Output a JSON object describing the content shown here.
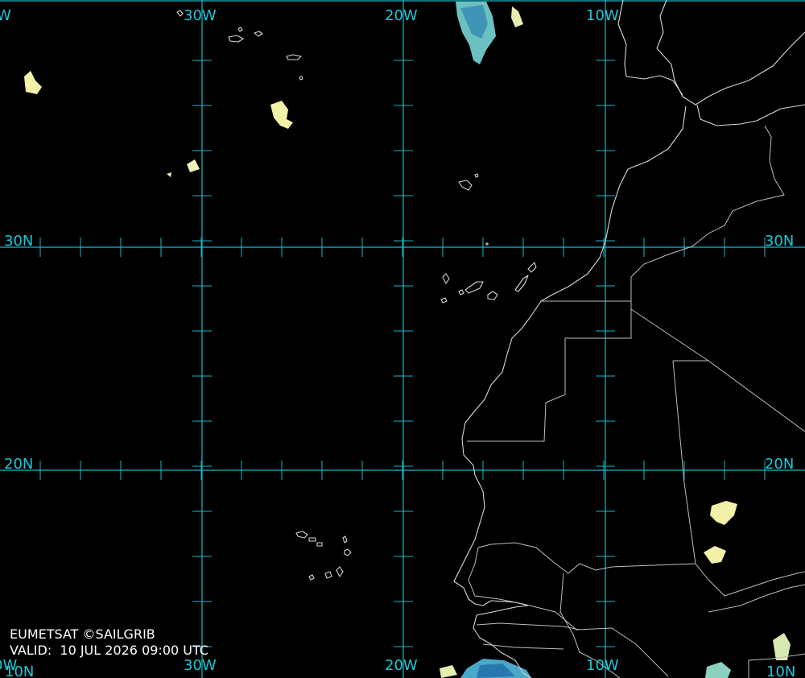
{
  "map": {
    "longitude_labels": {
      "w30": "30W",
      "w20": "20W",
      "w10": "10W",
      "w40_partial": "W",
      "w40_bottom_partial": "0W"
    },
    "latitude_labels": {
      "n30": "30N",
      "n20": "20N",
      "n10_right": "10N",
      "n10_left_partial": "10N"
    },
    "credit": "EUMETSAT ©SAILGRIB",
    "valid": "VALID:  10 JUL 2026 09:00 UTC",
    "colors": {
      "background": "#000000",
      "grid": "#19b8c8",
      "coastline": "#d8d8d8",
      "cloud_light": "#f3f0a8",
      "cloud_blue": "#5ab0c8"
    }
  }
}
